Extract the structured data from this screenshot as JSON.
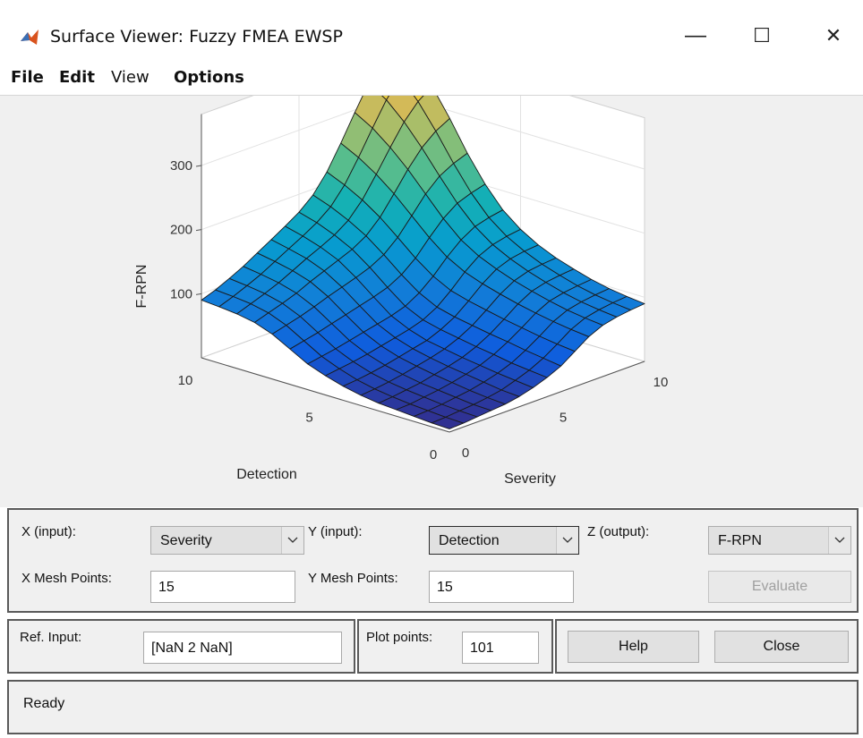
{
  "window": {
    "title": "Surface Viewer: Fuzzy FMEA EWSP",
    "minimize": "—",
    "maximize": "☐",
    "close": "✕"
  },
  "menu": [
    "File",
    "Edit",
    "View",
    "Options"
  ],
  "chart_data": {
    "type": "surface",
    "xlabel": "Severity",
    "ylabel": "Detection",
    "zlabel": "F-RPN",
    "x_ticks": [
      "0",
      "5",
      "10"
    ],
    "y_ticks": [
      "0",
      "5",
      "10"
    ],
    "z_ticks": [
      "100",
      "200",
      "300"
    ],
    "xlim": [
      0,
      10
    ],
    "ylim": [
      0,
      10
    ],
    "zlim": [
      0,
      380
    ],
    "mesh_points": 15,
    "grid": true,
    "colormap": "parula",
    "z_grid_15x15_rows_by_detection_cols_by_severity": [
      [
        5,
        6,
        8,
        10,
        12,
        16,
        22,
        30,
        40,
        55,
        70,
        80,
        85,
        88,
        90
      ],
      [
        6,
        7,
        9,
        11,
        14,
        18,
        25,
        33,
        44,
        58,
        73,
        83,
        88,
        91,
        93
      ],
      [
        8,
        9,
        11,
        14,
        17,
        22,
        28,
        36,
        48,
        62,
        77,
        87,
        92,
        95,
        97
      ],
      [
        10,
        11,
        14,
        17,
        21,
        26,
        32,
        41,
        53,
        67,
        82,
        93,
        98,
        101,
        103
      ],
      [
        12,
        14,
        17,
        20,
        25,
        30,
        36,
        45,
        57,
        72,
        88,
        100,
        106,
        109,
        111
      ],
      [
        16,
        18,
        21,
        25,
        30,
        35,
        41,
        50,
        62,
        78,
        95,
        108,
        115,
        118,
        120
      ],
      [
        22,
        24,
        27,
        31,
        36,
        41,
        46,
        55,
        67,
        84,
        103,
        118,
        126,
        130,
        132
      ],
      [
        30,
        33,
        36,
        40,
        45,
        50,
        55,
        62,
        74,
        92,
        113,
        130,
        140,
        145,
        148
      ],
      [
        40,
        44,
        48,
        53,
        58,
        63,
        68,
        75,
        88,
        106,
        128,
        147,
        160,
        166,
        170
      ],
      [
        55,
        60,
        65,
        71,
        77,
        83,
        89,
        96,
        108,
        126,
        150,
        172,
        188,
        196,
        202
      ],
      [
        70,
        76,
        82,
        89,
        97,
        104,
        111,
        119,
        131,
        150,
        176,
        202,
        222,
        234,
        242
      ],
      [
        80,
        87,
        94,
        102,
        112,
        121,
        130,
        139,
        152,
        173,
        202,
        232,
        258,
        276,
        288
      ],
      [
        85,
        93,
        101,
        110,
        121,
        132,
        142,
        153,
        168,
        192,
        224,
        258,
        290,
        314,
        330
      ],
      [
        88,
        96,
        105,
        115,
        127,
        139,
        151,
        164,
        181,
        207,
        242,
        280,
        316,
        344,
        362
      ],
      [
        90,
        98,
        108,
        119,
        132,
        145,
        158,
        172,
        191,
        219,
        256,
        296,
        334,
        364,
        375
      ]
    ]
  },
  "controls": {
    "x_input_label": "X (input):",
    "x_input_value": "Severity",
    "y_input_label": "Y (input):",
    "y_input_value": "Detection",
    "z_output_label": "Z (output):",
    "z_output_value": "F-RPN",
    "x_mesh_label": "X Mesh Points:",
    "x_mesh_value": "15",
    "y_mesh_label": "Y Mesh Points:",
    "y_mesh_value": "15",
    "evaluate_label": "Evaluate",
    "ref_input_label": "Ref. Input:",
    "ref_input_value": "[NaN 2 NaN]",
    "plot_points_label": "Plot points:",
    "plot_points_value": "101",
    "help_label": "Help",
    "close_label": "Close"
  },
  "status": {
    "text": "Ready"
  }
}
